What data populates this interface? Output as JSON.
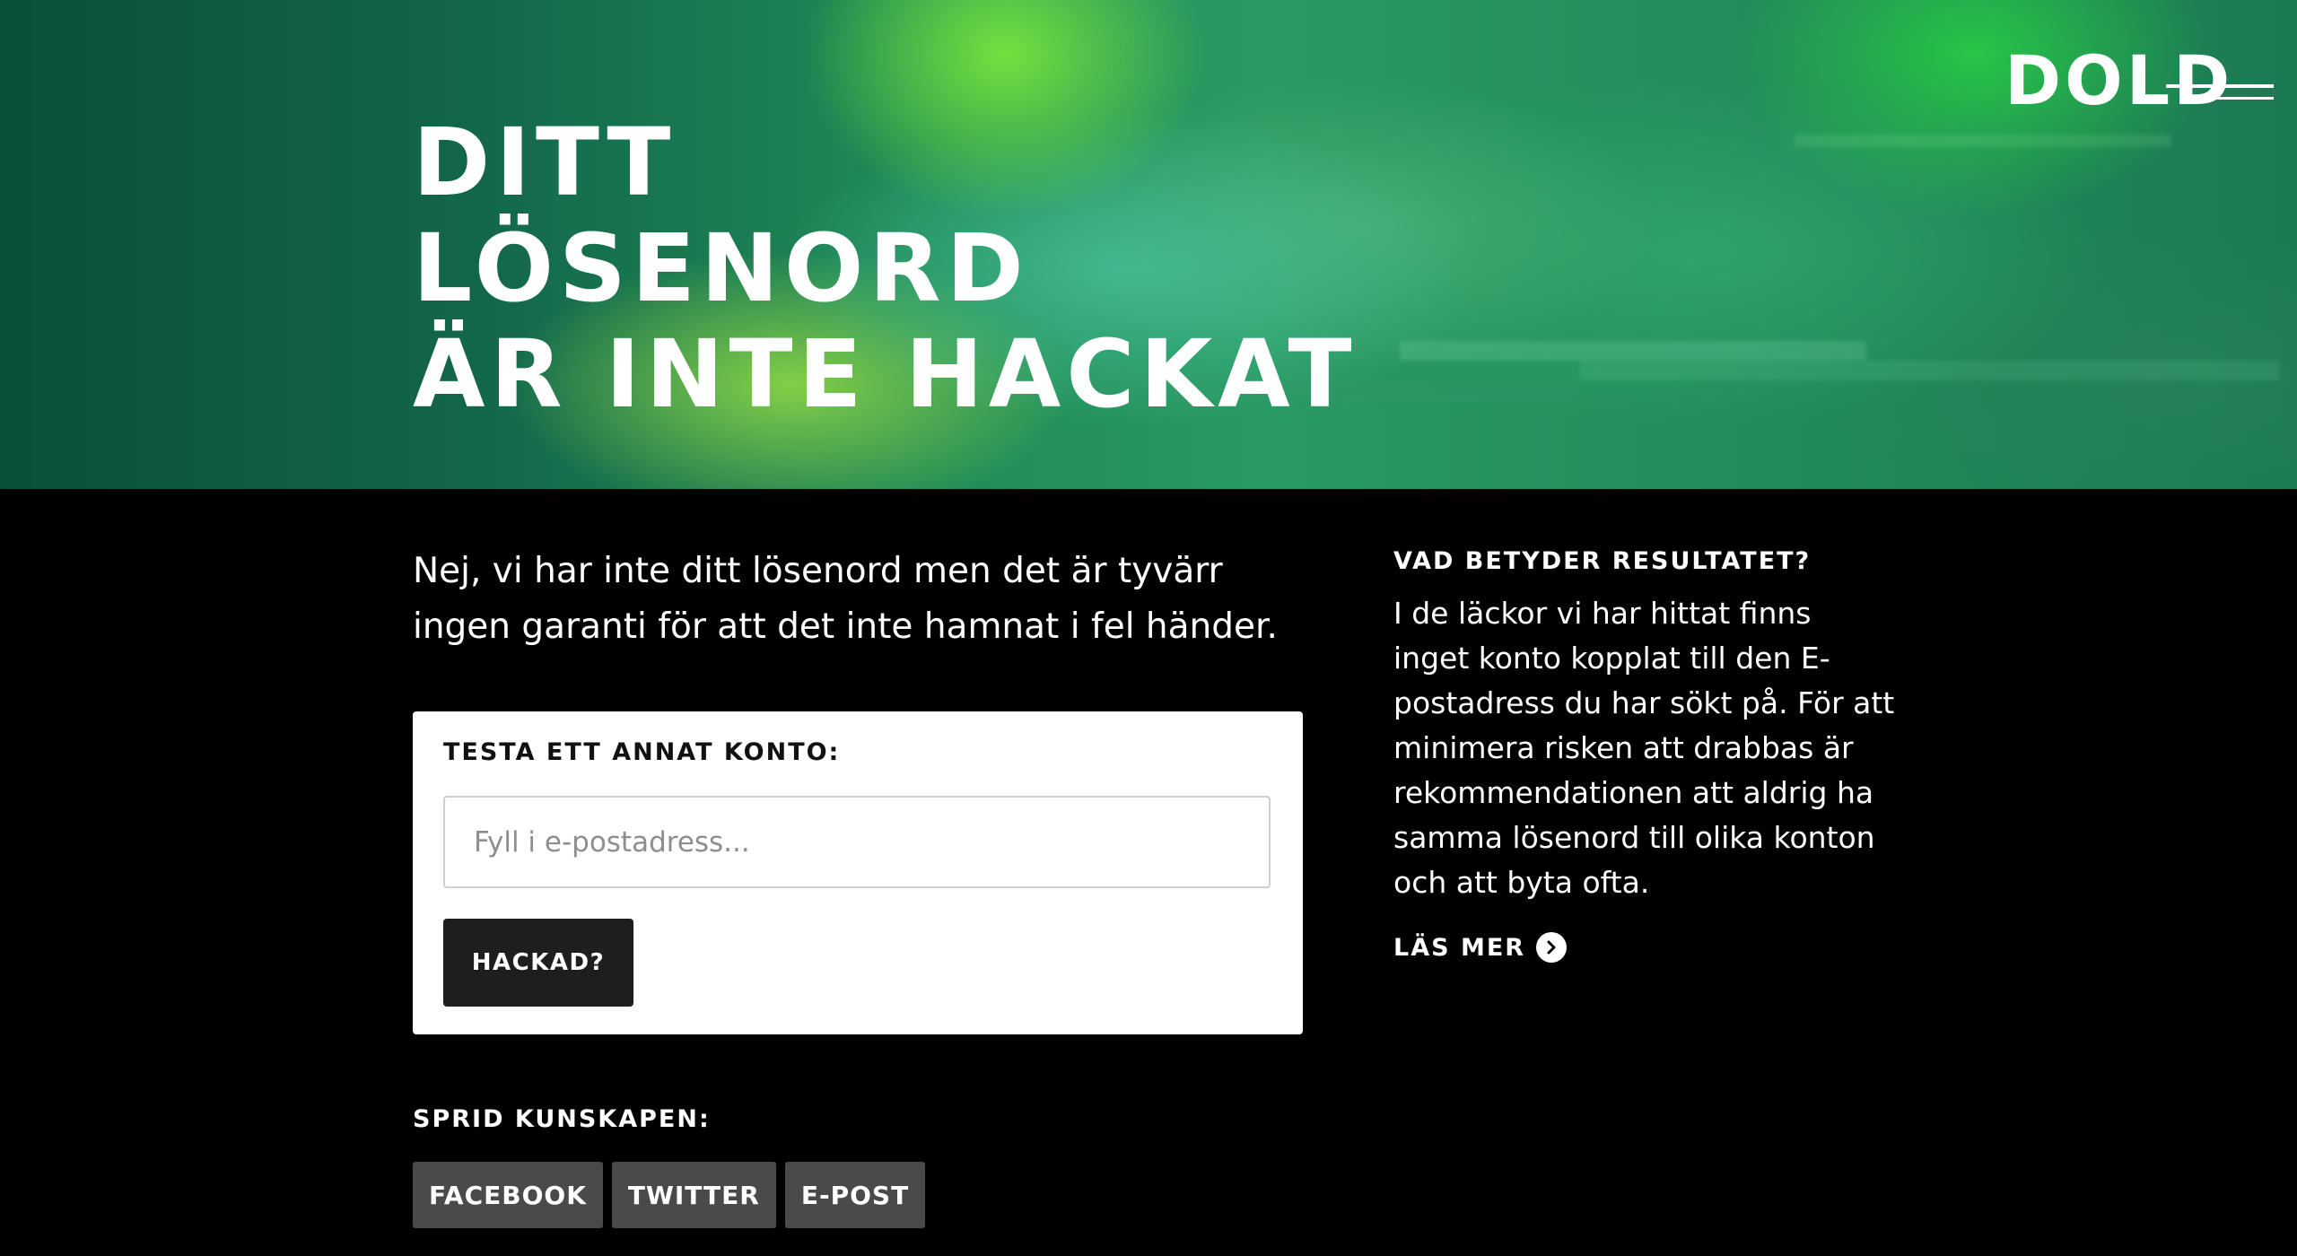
{
  "hero": {
    "title_lines": [
      "Ditt",
      "lösenord",
      "är inte hackat"
    ],
    "logo_text": "DOLD"
  },
  "main": {
    "intro": "Nej, vi har inte ditt lösenord men det är tyvärr ingen garanti för att det inte hamnat i fel händer.",
    "form": {
      "label": "Testa ett annat konto:",
      "email_placeholder": "Fyll i e-postadress...",
      "email_value": "",
      "submit_label": "Hackad?"
    },
    "share": {
      "label": "Sprid kunskapen:",
      "buttons": [
        "Facebook",
        "Twitter",
        "E-post"
      ]
    }
  },
  "aside": {
    "heading": "Vad betyder resultatet?",
    "body": "I de läckor vi har hittat finns inget konto kopplat till den E-postadress du har sökt på. För att minimera risken att drabbas är rekommendationen att aldrig ha samma lösenord till olika konton och att byta ofta.",
    "read_more": "Läs mer",
    "read_more_icon": "arrow-right-circle-icon"
  },
  "colors": {
    "background": "#000000",
    "card": "#ffffff",
    "primary_button": "#1e1e1e",
    "share_button": "#4a4a4a",
    "hero_green": "#2a9a63"
  }
}
